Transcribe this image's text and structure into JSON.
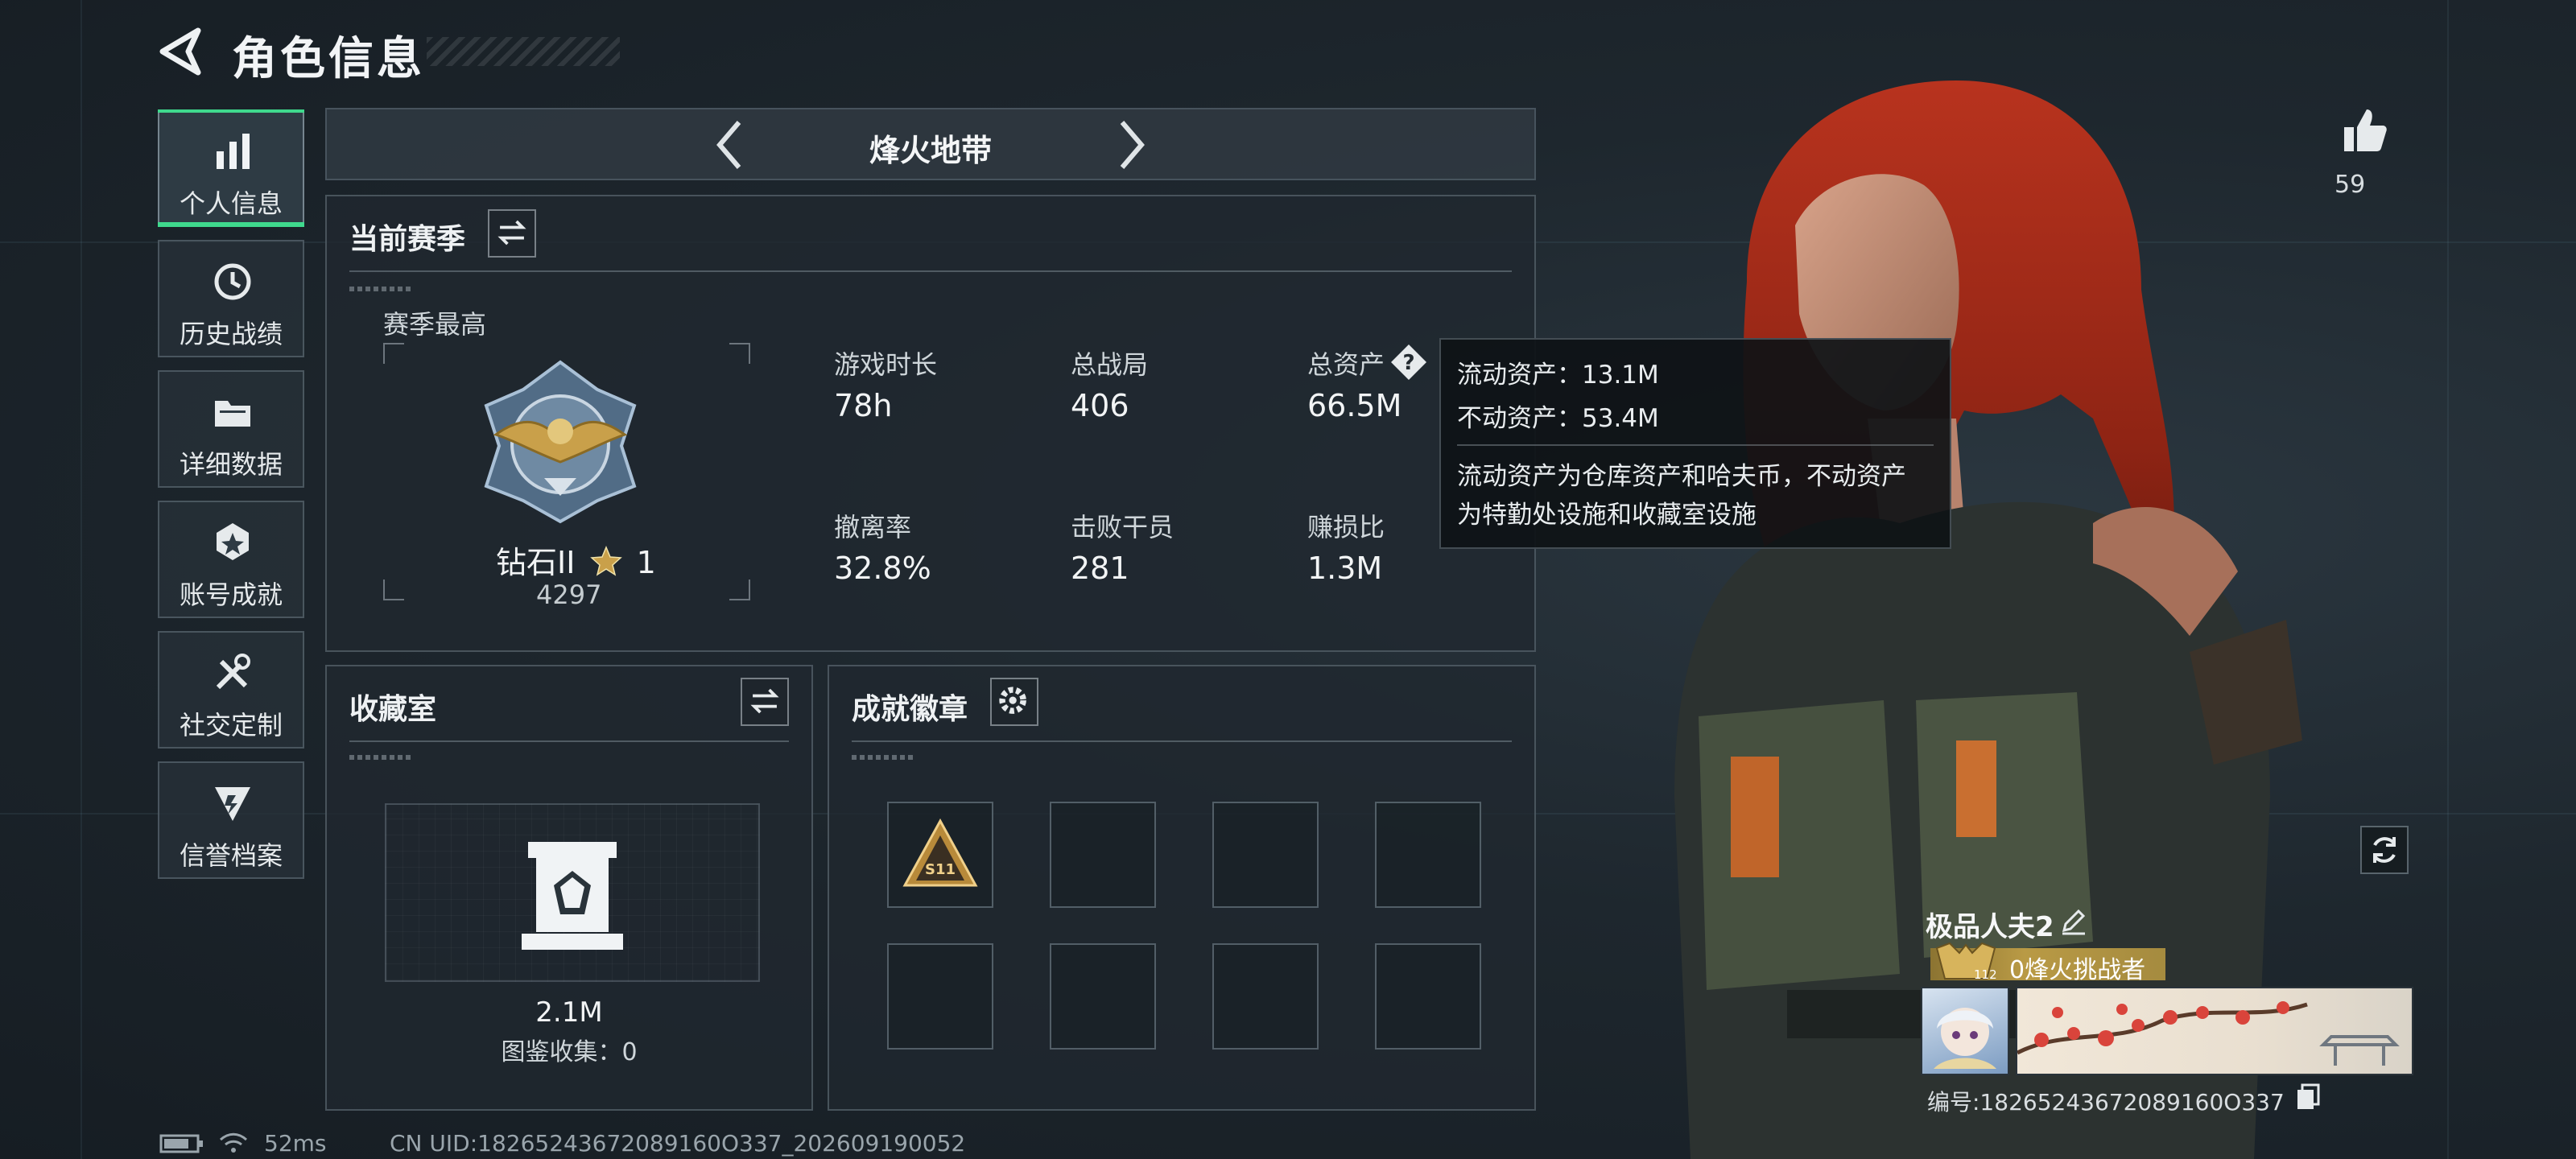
{
  "header": {
    "title": "角色信息"
  },
  "sidebar": {
    "items": [
      {
        "label": "个人信息",
        "icon": "bar-chart-icon",
        "active": true
      },
      {
        "label": "历史战绩",
        "icon": "history-clock-icon",
        "active": false
      },
      {
        "label": "详细数据",
        "icon": "folder-icon",
        "active": false
      },
      {
        "label": "账号成就",
        "icon": "achievement-badge-icon",
        "active": false
      },
      {
        "label": "社交定制",
        "icon": "tools-icon",
        "active": false
      },
      {
        "label": "信誉档案",
        "icon": "credit-badge-icon",
        "active": false
      }
    ]
  },
  "mode": {
    "title": "烽火地带"
  },
  "season": {
    "title": "当前赛季",
    "best_label": "赛季最高",
    "rank_name": "钻石II",
    "rank_star": "1",
    "rank_score": "4297",
    "stats": [
      {
        "label": "游戏时长",
        "value": "78h"
      },
      {
        "label": "总战局",
        "value": "406"
      },
      {
        "label": "总资产",
        "value": "66.5M"
      },
      {
        "label": "撤离率",
        "value": "32.8%"
      },
      {
        "label": "击败干员",
        "value": "281"
      },
      {
        "label": "赚损比",
        "value": "1.3M"
      }
    ]
  },
  "tooltip": {
    "liquid": "流动资产：13.1M",
    "fixed": "不动资产：53.4M",
    "desc_line1": "流动资产为仓库资产和哈夫币，不动资产",
    "desc_line2": "为特勤处设施和收藏室设施"
  },
  "collection": {
    "title": "收藏室",
    "value": "2.1M",
    "catalog": "图鉴收集：0"
  },
  "achievements": {
    "title": "成就徽章",
    "first_badge_label": "S11"
  },
  "player": {
    "name": "极品人夫2",
    "level": "112",
    "rank_title": "0烽火挑战者",
    "id": "编号:18265243672089160O337"
  },
  "likes": {
    "count": "59"
  },
  "status": {
    "ping": "52ms",
    "uid": "CN UID:18265243672089160O337_202609190052"
  },
  "colors": {
    "accent": "#3fd98d",
    "gold": "#b99a45"
  }
}
